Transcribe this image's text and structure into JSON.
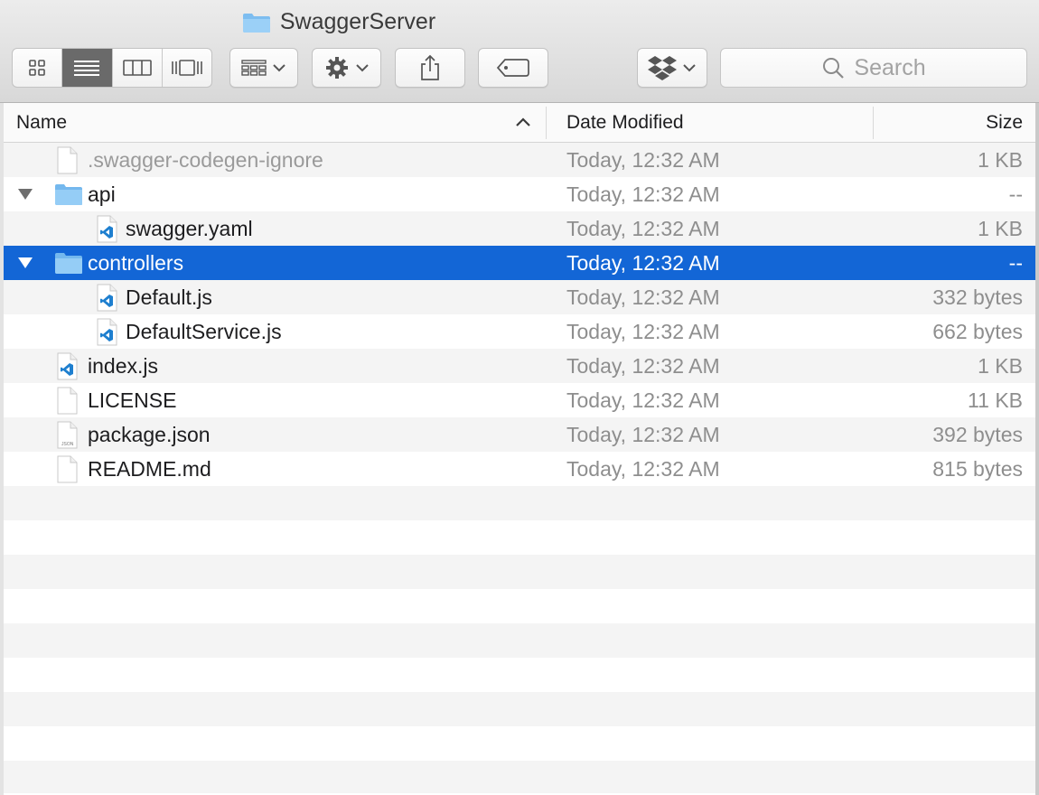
{
  "window": {
    "title": "SwaggerServer"
  },
  "toolbar": {
    "view_modes": [
      "icon-view",
      "list-view",
      "column-view",
      "cover-flow-view"
    ],
    "active_view": "list-view",
    "search_placeholder": "Search"
  },
  "columns": {
    "name": "Name",
    "date": "Date Modified",
    "size": "Size",
    "sort_indicator": "^"
  },
  "rows": [
    {
      "name": ".swagger-codegen-ignore",
      "date": "Today, 12:32 AM",
      "size": "1 KB",
      "icon": "blank-file-icon",
      "level": 0,
      "state": "dimmed"
    },
    {
      "name": "api",
      "date": "Today, 12:32 AM",
      "size": "--",
      "icon": "folder-icon",
      "level": 0,
      "expanded": true
    },
    {
      "name": "swagger.yaml",
      "date": "Today, 12:32 AM",
      "size": "1 KB",
      "icon": "vscode-file-icon",
      "level": 1
    },
    {
      "name": "controllers",
      "date": "Today, 12:32 AM",
      "size": "--",
      "icon": "folder-icon",
      "level": 0,
      "expanded": true,
      "state": "selected"
    },
    {
      "name": "Default.js",
      "date": "Today, 12:32 AM",
      "size": "332 bytes",
      "icon": "vscode-file-icon",
      "level": 1
    },
    {
      "name": "DefaultService.js",
      "date": "Today, 12:32 AM",
      "size": "662 bytes",
      "icon": "vscode-file-icon",
      "level": 1
    },
    {
      "name": "index.js",
      "date": "Today, 12:32 AM",
      "size": "1 KB",
      "icon": "vscode-file-icon",
      "level": 0
    },
    {
      "name": "LICENSE",
      "date": "Today, 12:32 AM",
      "size": "11 KB",
      "icon": "blank-file-icon",
      "level": 0
    },
    {
      "name": "package.json",
      "date": "Today, 12:32 AM",
      "size": "392 bytes",
      "icon": "json-file-icon",
      "level": 0
    },
    {
      "name": "README.md",
      "date": "Today, 12:32 AM",
      "size": "815 bytes",
      "icon": "blank-file-icon",
      "level": 0
    }
  ],
  "colors": {
    "selection": "#1366d6",
    "folder": "#8cc8f5",
    "vscode": "#1e7fcf"
  }
}
